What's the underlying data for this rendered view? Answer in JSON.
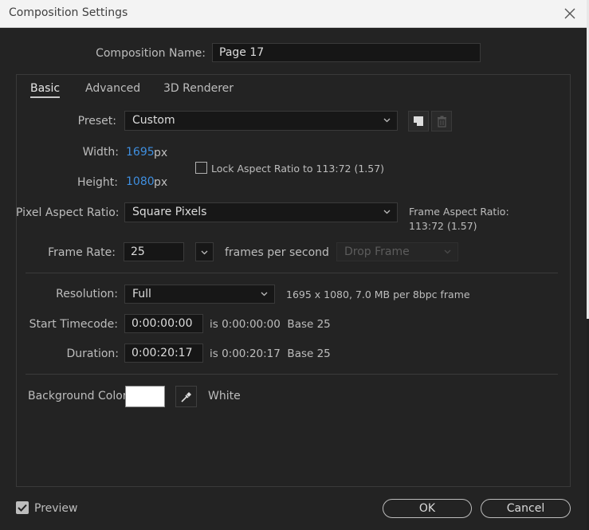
{
  "window": {
    "title": "Composition Settings"
  },
  "comp_name": {
    "label": "Composition Name:",
    "value": "Page 17"
  },
  "tabs": [
    {
      "label": "Basic",
      "active": true
    },
    {
      "label": "Advanced",
      "active": false
    },
    {
      "label": "3D Renderer",
      "active": false
    }
  ],
  "preset": {
    "label": "Preset:",
    "value": "Custom"
  },
  "width": {
    "label": "Width:",
    "value": "1695",
    "unit": "px"
  },
  "height": {
    "label": "Height:",
    "value": "1080",
    "unit": "px"
  },
  "lock_aspect": {
    "label": "Lock Aspect Ratio to 113:72 (1.57)",
    "checked": false
  },
  "pixel_aspect": {
    "label": "Pixel Aspect Ratio:",
    "value": "Square Pixels"
  },
  "frame_aspect": {
    "label": "Frame Aspect Ratio:",
    "value": "113:72 (1.57)"
  },
  "frame_rate": {
    "label": "Frame Rate:",
    "value": "25",
    "unit": "frames per second",
    "drop_frame": "Drop Frame"
  },
  "resolution": {
    "label": "Resolution:",
    "value": "Full",
    "info": "1695 x 1080, 7.0 MB per 8bpc frame"
  },
  "start_timecode": {
    "label": "Start Timecode:",
    "value": "0:00:00:00",
    "info": "is 0:00:00:00  Base 25"
  },
  "duration": {
    "label": "Duration:",
    "value": "0:00:20:17",
    "info": "is 0:00:20:17  Base 25"
  },
  "background": {
    "label": "Background Color:",
    "color": "#ffffff",
    "name": "White"
  },
  "preview": {
    "label": "Preview",
    "checked": true
  },
  "buttons": {
    "ok": "OK",
    "cancel": "Cancel"
  },
  "colors": {
    "accent_blue": "#3f8fe0",
    "dialog_bg": "#232323",
    "titlebar_bg": "#f3f3f3"
  }
}
